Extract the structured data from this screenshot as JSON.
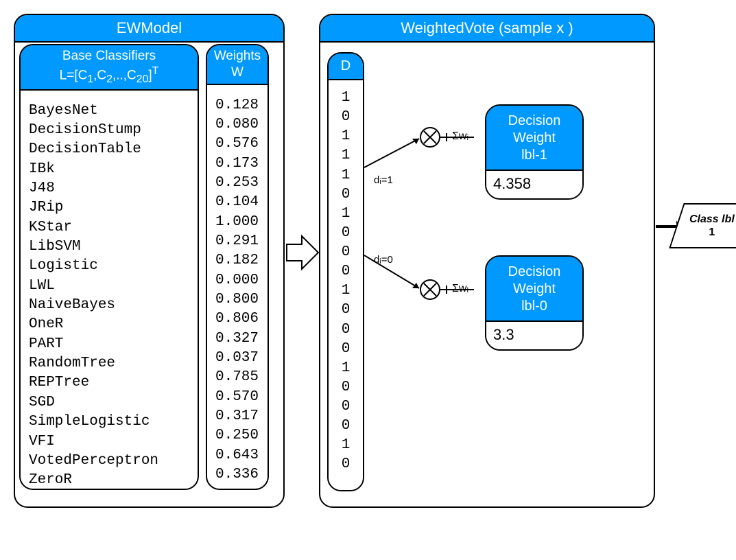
{
  "ewmodel": {
    "title": "EWModel",
    "classifiers_header_line1": "Base Classifiers",
    "classifiers_header_line2_html": "L=[C<sub>1</sub>,C<sub>2</sub>,..,C<sub>20</sub>]<sup>T</sup>",
    "weights_header_line1": "Weights",
    "weights_header_line2": "W",
    "classifiers": [
      "BayesNet",
      "DecisionStump",
      "DecisionTable",
      "IBk",
      "J48",
      "JRip",
      "KStar",
      "LibSVM",
      "Logistic",
      "LWL",
      "NaiveBayes",
      "OneR",
      "PART",
      "RandomTree",
      "REPTree",
      "SGD",
      "SimpleLogistic",
      "VFI",
      "VotedPerceptron",
      "ZeroR"
    ],
    "weights": [
      "0.128",
      "0.080",
      "0.576",
      "0.173",
      "0.253",
      "0.104",
      "1.000",
      "0.291",
      "0.182",
      "0.000",
      "0.800",
      "0.806",
      "0.327",
      "0.037",
      "0.785",
      "0.570",
      "0.317",
      "0.250",
      "0.643",
      "0.336"
    ]
  },
  "wvote": {
    "title": "WeightedVote (sample x )",
    "d_header": "D",
    "d_values": [
      "1",
      "0",
      "1",
      "1",
      "1",
      "0",
      "1",
      "0",
      "0",
      "0",
      "1",
      "0",
      "0",
      "0",
      "1",
      "0",
      "0",
      "0",
      "1",
      "0"
    ],
    "cond1": "dᵢ=1",
    "cond0": "dᵢ=0",
    "sum_label": "Σwᵢ",
    "dec1_l1": "Decision",
    "dec1_l2": "Weight",
    "dec1_l3": "lbl-1",
    "dec1_val": "4.358",
    "dec0_l1": "Decision",
    "dec0_l2": "Weight",
    "dec0_l3": "lbl-0",
    "dec0_val": "3.3"
  },
  "output": {
    "label": "Class lbl",
    "class": "1"
  }
}
